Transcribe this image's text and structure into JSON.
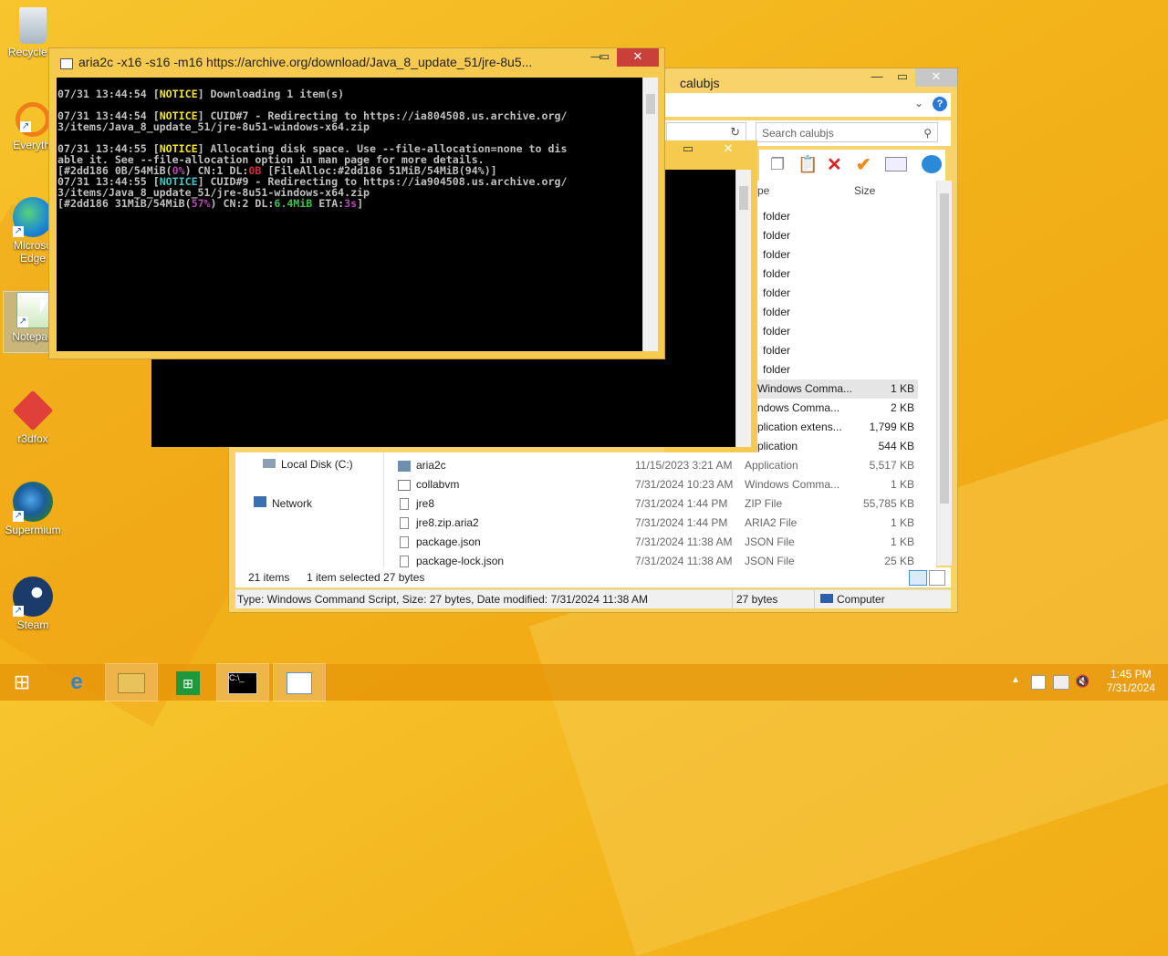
{
  "desktop": {
    "icons": [
      {
        "label": "Recycle Bin",
        "shown": "Recycle B"
      },
      {
        "label": "Everything",
        "shown": "Everythi"
      },
      {
        "label": "Microsoft Edge",
        "shown": "Microso Edge"
      },
      {
        "label": "Notepad",
        "shown": "Notepad"
      },
      {
        "label": "r3dfox",
        "shown": "r3dfox"
      },
      {
        "label": "Supermium",
        "shown": "Supermium"
      },
      {
        "label": "Steam",
        "shown": "Steam"
      }
    ]
  },
  "aria_window": {
    "title": "aria2c  -x16 -s16 -m16 https://archive.org/download/Java_8_update_51/jre-8u5...",
    "lines": [
      {
        "pre": "07/31 13:44:54 [",
        "tag": "NOTICE",
        "post": "] Downloading 1 item(s)"
      },
      {
        "pre": "",
        "tag": "",
        "post": ""
      },
      {
        "pre": "07/31 13:44:54 [",
        "tag": "NOTICE",
        "post": "] CUID#7 - Redirecting to https://ia804508.us.archive.org/"
      },
      {
        "pre": "3/items/Java_8_update_51/jre-8u51-windows-x64.zip",
        "tag": "",
        "post": ""
      },
      {
        "pre": "",
        "tag": "",
        "post": ""
      },
      {
        "pre": "07/31 13:44:55 [",
        "tag": "NOTICE",
        "post": "] Allocating disk space. Use --file-allocation=none to dis"
      },
      {
        "pre": "able it. See --file-allocation option in man page for more details.",
        "tag": "",
        "post": ""
      }
    ],
    "progress1": {
      "a": "[#2dd186 0B/54MiB(",
      "pct": "0%",
      "b": ") CN:1 DL:",
      "dl": "0B",
      "c": " [FileAlloc:#2dd186 51MiB/54MiB(94%)]"
    },
    "line_after1": "07/31 13:44:55 [",
    "line_after1_tag": "NOTICE",
    "line_after1_post": "] CUID#9 - Redirecting to https://ia904508.us.archive.org/",
    "line_after2": "3/items/Java_8_update_51/jre-8u51-windows-x64.zip",
    "progress2": {
      "a": "[#2dd186 31MiB/54MiB(",
      "pct": "57%",
      "b": ") CN:2 DL:",
      "dl": "6.4MiB",
      "c": " ETA:",
      "eta": "3s",
      "d": "]"
    }
  },
  "explorer": {
    "title": "calubjs",
    "search_placeholder": "Search calubjs",
    "col_type": "pe",
    "col_size": "Size",
    "partial_rows": [
      {
        "type": "folder",
        "size": ""
      },
      {
        "type": "folder",
        "size": ""
      },
      {
        "type": "folder",
        "size": ""
      },
      {
        "type": "folder",
        "size": ""
      },
      {
        "type": "folder",
        "size": ""
      },
      {
        "type": "folder",
        "size": ""
      },
      {
        "type": "folder",
        "size": ""
      },
      {
        "type": "folder",
        "size": ""
      },
      {
        "type": "folder",
        "size": ""
      },
      {
        "type": "Windows Comma...",
        "size": "1 KB"
      },
      {
        "type": "ndows Comma...",
        "size": "2 KB"
      },
      {
        "type": "plication extens...",
        "size": "1,799 KB"
      },
      {
        "type": "plication",
        "size": "544 KB"
      }
    ],
    "nav": [
      {
        "label": "Local Disk (C:)"
      },
      {
        "label": "Network"
      }
    ],
    "files": [
      {
        "name": "aria2c",
        "date": "11/15/2023 3:21 AM",
        "type": "Application",
        "size": "5,517 KB"
      },
      {
        "name": "collabvm",
        "date": "7/31/2024 10:23 AM",
        "type": "Windows Comma...",
        "size": "1 KB"
      },
      {
        "name": "jre8",
        "date": "7/31/2024 1:44 PM",
        "type": "ZIP File",
        "size": "55,785 KB"
      },
      {
        "name": "jre8.zip.aria2",
        "date": "7/31/2024 1:44 PM",
        "type": "ARIA2 File",
        "size": "1 KB"
      },
      {
        "name": "package.json",
        "date": "7/31/2024 11:38 AM",
        "type": "JSON File",
        "size": "1 KB"
      },
      {
        "name": "package-lock.json",
        "date": "7/31/2024 11:38 AM",
        "type": "JSON File",
        "size": "25 KB"
      }
    ],
    "items_count": "21 items",
    "selected": "1 item selected  27 bytes",
    "status_info": "Type: Windows Command Script, Size: 27 bytes, Date modified: 7/31/2024 11:38 AM",
    "status_size": "27 bytes",
    "status_location": "Computer"
  },
  "taskbar": {
    "time": "1:45 PM",
    "date": "7/31/2024"
  }
}
